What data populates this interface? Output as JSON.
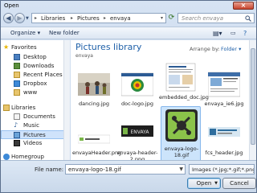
{
  "window": {
    "title": "Open"
  },
  "nav": {
    "breadcrumb": [
      "Libraries",
      "Pictures",
      "envaya"
    ],
    "search_placeholder": "Search envaya"
  },
  "toolbar": {
    "organize_label": "Organize",
    "new_folder_label": "New folder"
  },
  "sidebar": {
    "favorites_label": "Favorites",
    "favorites": [
      "Desktop",
      "Downloads",
      "Recent Places",
      "Dropbox",
      "www"
    ],
    "libraries_label": "Libraries",
    "libraries": [
      "Documents",
      "Music",
      "Pictures",
      "Videos"
    ],
    "homegroup_label": "Homegroup"
  },
  "main": {
    "title": "Pictures library",
    "subtitle": "envaya",
    "arrange_label": "Arrange by:",
    "arrange_value": "Folder"
  },
  "files": [
    {
      "name": "dancing.jpg"
    },
    {
      "name": "doc-logo.jpg"
    },
    {
      "name": "embedded_doc.jpg"
    },
    {
      "name": "envaya_ie6.jpg"
    },
    {
      "name": "envayaHeader.png"
    },
    {
      "name": "envaya-header-2.png"
    },
    {
      "name": "envaya-logo-18.gif"
    },
    {
      "name": "fcs_header.jpg"
    }
  ],
  "thumb_text": {
    "envaya_logo": "ENVAYA"
  },
  "bottom": {
    "file_name_label": "File name:",
    "file_name_value": "envaya-logo-18.gif",
    "file_type_value": "Images (*.jpg;*.gif;*.png;*.doc;",
    "open_label": "Open",
    "cancel_label": "Cancel"
  },
  "colors": {
    "link_blue": "#1d5fa8",
    "selection": "#cce4fb",
    "close_red": "#c8442e"
  }
}
